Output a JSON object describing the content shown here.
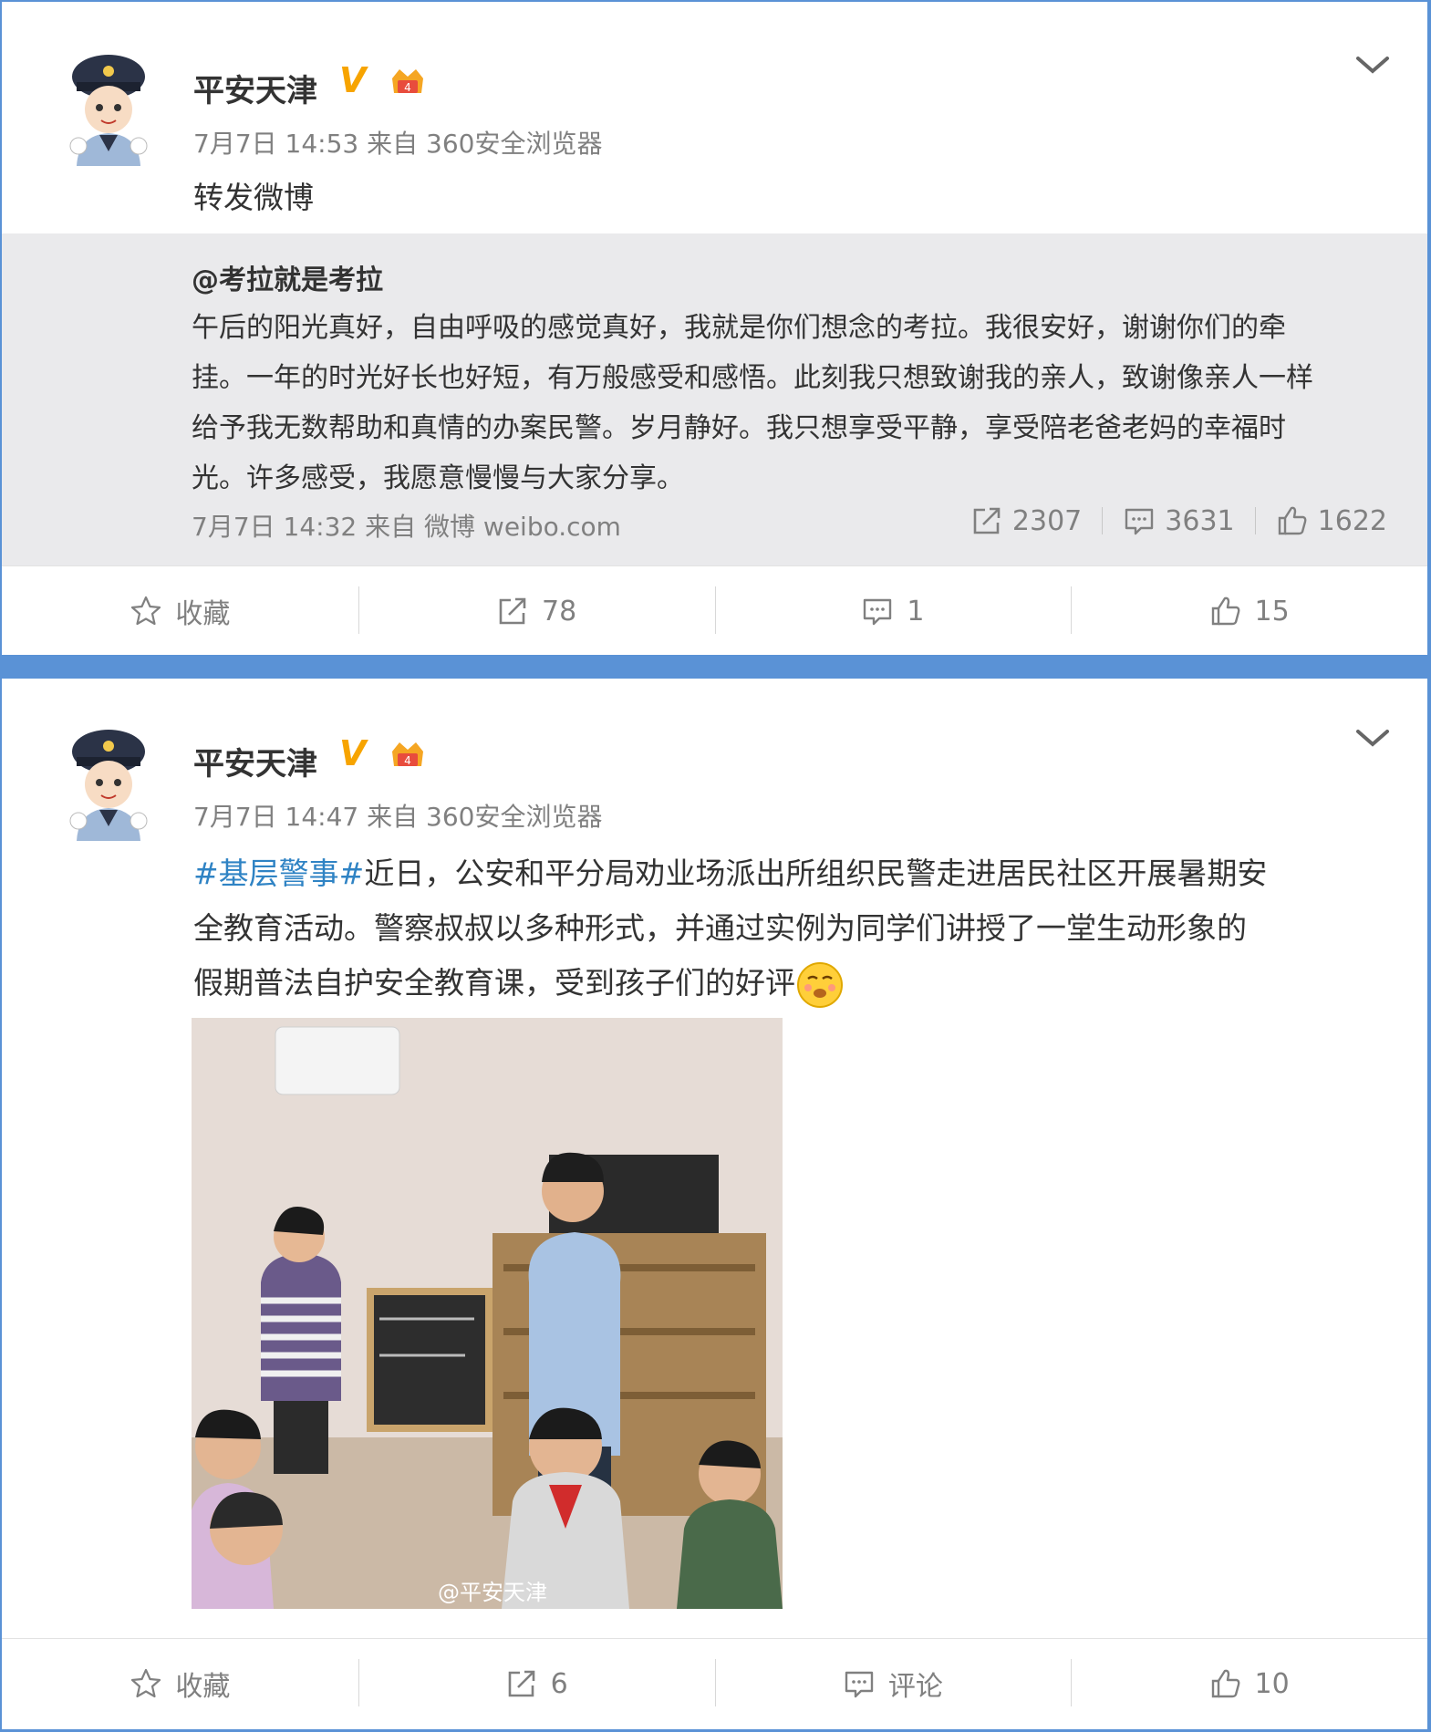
{
  "post1": {
    "username": "平安天津",
    "verified_badge": "V",
    "timestamp": "7月7日 14:53 来自 360安全浏览器",
    "text": "转发微博",
    "quoted": {
      "author": "@考拉就是考拉",
      "lines": [
        "午后的阳光真好，自由呼吸的感觉真好，我就是你们想念的考拉。我很安好，谢谢你们的牵",
        "挂。一年的时光好长也好短，有万般感受和感悟。此刻我只想致谢我的亲人，致谢像亲人一样",
        "给予我无数帮助和真情的办案民警。岁月静好。我只想享受平静，享受陪老爸老妈的幸福时",
        "光。许多感受，我愿意慢慢与大家分享。"
      ],
      "meta": "7月7日 14:32 来自 微博 weibo.com",
      "reposts": "2307",
      "comments": "3631",
      "likes": "1622"
    },
    "actions": {
      "favorite": "收藏",
      "reposts": "78",
      "comments": "1",
      "likes": "15"
    }
  },
  "post2": {
    "username": "平安天津",
    "verified_badge": "V",
    "timestamp": "7月7日 14:47 来自 360安全浏览器",
    "hashtag": "#基层警事#",
    "line1": "近日，公安和平分局劝业场派出所组织民警走进居民社区开展暑期安",
    "line2": "全教育活动。警察叔叔以多种形式，并通过实例为同学们讲授了一堂生动形象的",
    "line3": "假期普法自护安全教育课，受到孩子们的好评",
    "photo_watermark": "@平安天津",
    "actions": {
      "favorite": "收藏",
      "reposts": "6",
      "comments": "评论",
      "likes": "10"
    }
  },
  "icons": [
    "police-avatar-icon",
    "crown-icon",
    "chevron-down-icon",
    "star-icon",
    "repost-icon",
    "comment-icon",
    "like-icon",
    "emoji-icon"
  ],
  "colors": {
    "background": "#5a92d6",
    "link": "#2f83c4",
    "quote_bg": "#eaeaec",
    "verified": "#f7a400"
  }
}
